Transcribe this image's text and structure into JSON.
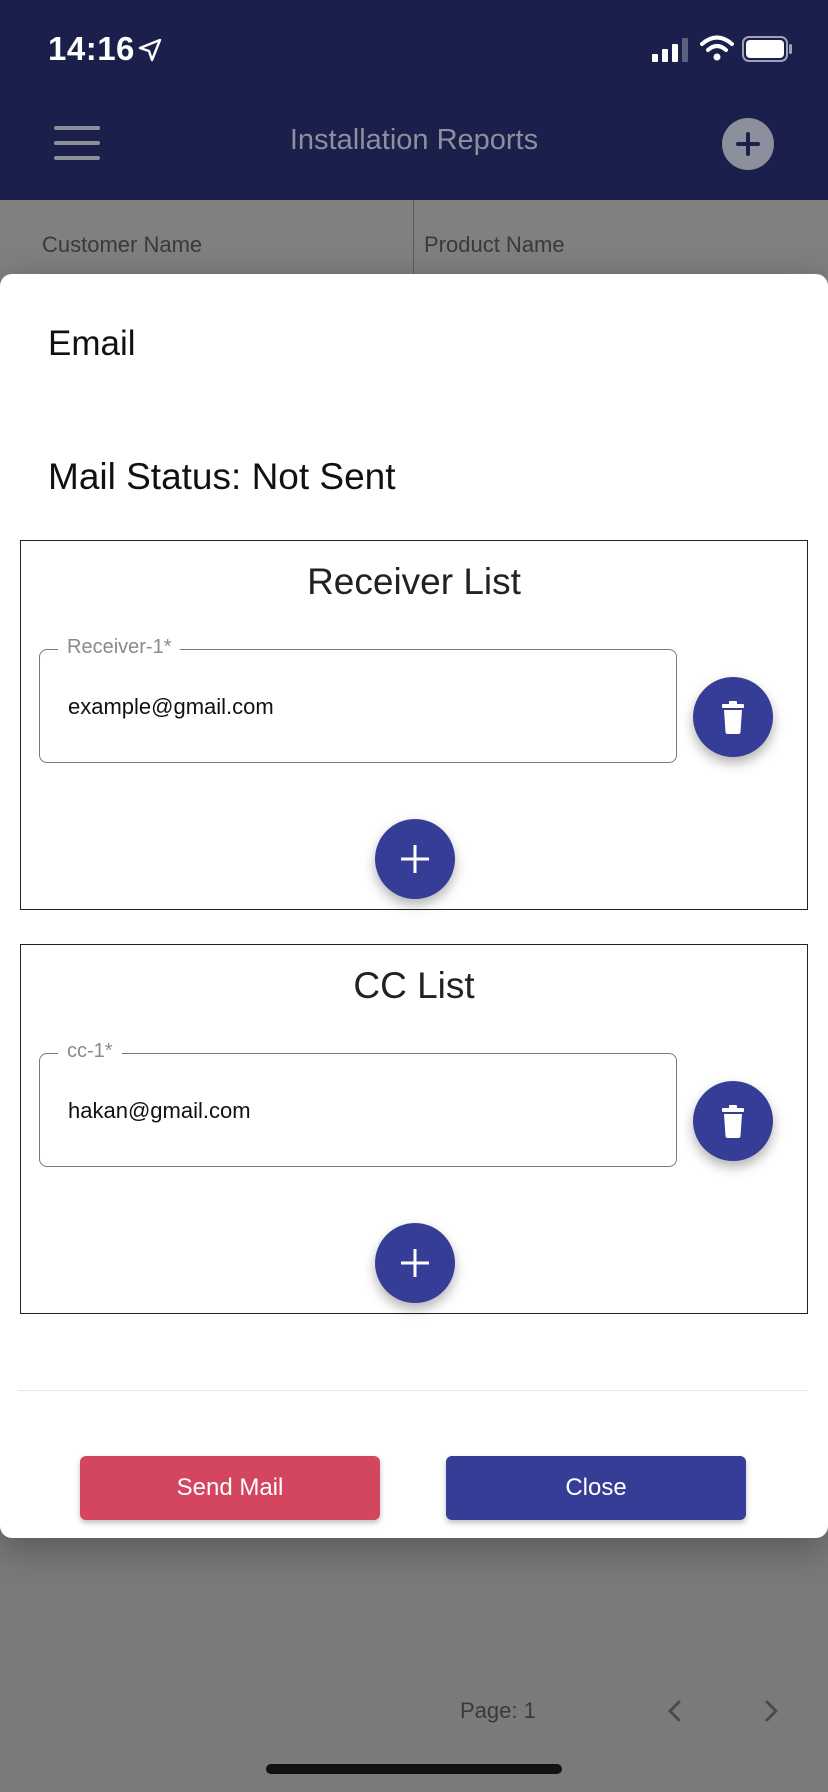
{
  "status_bar": {
    "time": "14:16"
  },
  "app_bar": {
    "title": "Installation Reports"
  },
  "table": {
    "columns": [
      "Customer Name",
      "Product Name"
    ]
  },
  "pager": {
    "label": "Page: 1"
  },
  "modal": {
    "heading": "Email",
    "mail_status": "Mail Status: Not Sent",
    "receiver_list": {
      "title": "Receiver List",
      "fields": [
        {
          "label": "Receiver-1*",
          "value": "example@gmail.com"
        }
      ]
    },
    "cc_list": {
      "title": "CC List",
      "fields": [
        {
          "label": "cc-1*",
          "value": "hakan@gmail.com"
        }
      ]
    },
    "buttons": {
      "send": "Send Mail",
      "close": "Close"
    }
  },
  "colors": {
    "app_bar": "#1b1f4c",
    "primary": "#353d96",
    "danger": "#d4455f"
  },
  "icons": [
    "location-arrow-icon",
    "signal-icon",
    "wifi-icon",
    "battery-icon",
    "menu-icon",
    "add-circle-icon",
    "trash-icon",
    "plus-icon",
    "chevron-left-icon",
    "chevron-right-icon"
  ]
}
